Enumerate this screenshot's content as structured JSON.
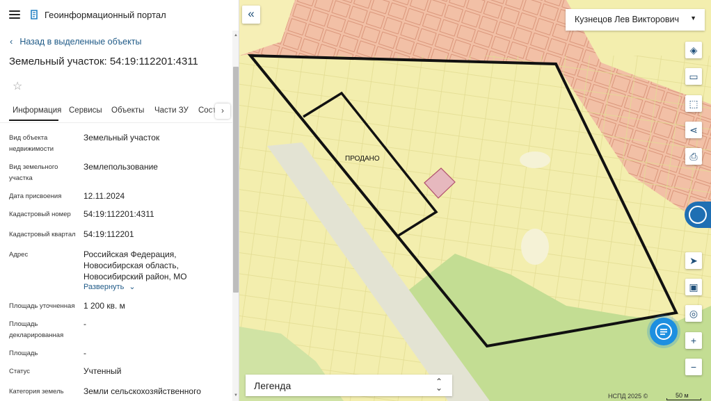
{
  "header": {
    "app_title": "Геоинформационный портал",
    "menu_icon": "hamburger-menu-icon",
    "logo_icon": "portal-logo-icon"
  },
  "panel": {
    "back_label": "Назад в выделенные объекты",
    "object_title": "Земельный участок: 54:19:112201:4311",
    "tabs": [
      {
        "label": "Информация"
      },
      {
        "label": "Сервисы"
      },
      {
        "label": "Объекты"
      },
      {
        "label": "Части ЗУ"
      },
      {
        "label": "Соста"
      }
    ],
    "properties": [
      {
        "label": "Вид объекта недвижимости",
        "value": "Земельный участок"
      },
      {
        "label": "Вид земельного участка",
        "value": "Землепользование"
      },
      {
        "label": "Дата присвоения",
        "value": "12.11.2024"
      },
      {
        "label": "Кадастровый номер",
        "value": "54:19:112201:4311"
      },
      {
        "label": "Кадастровый квартал",
        "value": "54:19:112201"
      },
      {
        "label": "Адрес",
        "value": "Российская Федерация, Новосибирская область, Новосибирский район, МО"
      },
      {
        "label": "Площадь уточненная",
        "value": "1 200 кв. м"
      },
      {
        "label": "Площадь декларированная",
        "value": "-"
      },
      {
        "label": "Площадь",
        "value": "-"
      },
      {
        "label": "Статус",
        "value": "Учтенный"
      },
      {
        "label": "Категория земель",
        "value": "Земли сельскохозяйственного"
      }
    ],
    "expand_label": "Развернуть"
  },
  "map": {
    "user_name": "Кузнецов Лев Викторович",
    "sold_label": "ПРОДАНО",
    "legend_label": "Легенда",
    "attribution": "НСПД 2025 ©",
    "scale": "50 м",
    "tools": [
      {
        "name": "layers-icon",
        "glyph": "◈"
      },
      {
        "name": "ruler-icon",
        "glyph": "▭"
      },
      {
        "name": "area-select-icon",
        "glyph": "⬚"
      },
      {
        "name": "share-icon",
        "glyph": "⋖"
      },
      {
        "name": "print-icon",
        "glyph": "⎙"
      },
      {
        "name": "locate-icon",
        "glyph": "➤"
      },
      {
        "name": "minimap-icon",
        "glyph": "▣"
      },
      {
        "name": "geolocation-icon",
        "glyph": "◎"
      },
      {
        "name": "zoom-in-icon",
        "glyph": "+"
      },
      {
        "name": "zoom-out-icon",
        "glyph": "−"
      }
    ],
    "colors": {
      "land": "#f3eeae",
      "built_area": "#f2c2a8",
      "forest": "#c3dd93",
      "road": "#e5e5d5",
      "boundary": "#111111",
      "parcel": "#e6b8be",
      "accent": "#1f6fb3"
    }
  }
}
